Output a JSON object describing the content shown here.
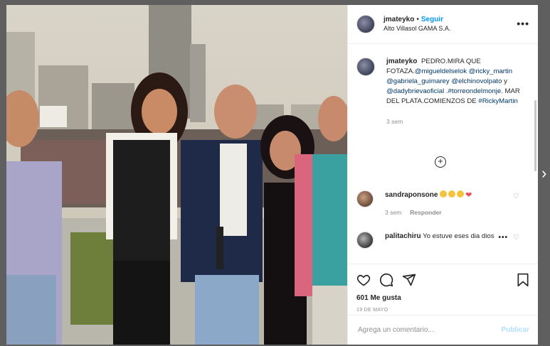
{
  "post": {
    "username": "jmateyko",
    "separator": "•",
    "follow_label": "Seguir",
    "location": "Alto Villasol GAMA S.A.",
    "more_icon": "more-horizontal-icon"
  },
  "caption": {
    "username": "jmateyko",
    "text_1": "PEDRO.MIRA QUE FOTAZA.",
    "mentions_1": "@migueldelselok @ricky_martin @gabriela_guimarey @elchinovolpato",
    "text_2": "y",
    "mentions_2": "@dadybrievaoficial .#torreondelmonje",
    "text_3": ". MAR DEL PLATA.COMIENZOS DE",
    "hashtag": "#RickyMartin",
    "time": "3 sem"
  },
  "load_more_icon": "plus-circle-icon",
  "comments": [
    {
      "username": "sandraponsone",
      "text": "",
      "emojis": [
        "clap",
        "clap",
        "clap",
        "heart"
      ],
      "time": "3 sem",
      "reply_label": "Responder"
    },
    {
      "username": "palitachiru",
      "text": "Yo estuve eses dia dios"
    }
  ],
  "actions": {
    "likes": "601 Me gusta",
    "date": "19 DE MAYO"
  },
  "add_comment": {
    "placeholder": "Agrega un comentario...",
    "publish_label": "Publicar"
  },
  "colors": {
    "accent": "#0095f6",
    "link": "#00376b",
    "muted": "#8e8e8e",
    "publish_disabled": "#b2dffc"
  }
}
